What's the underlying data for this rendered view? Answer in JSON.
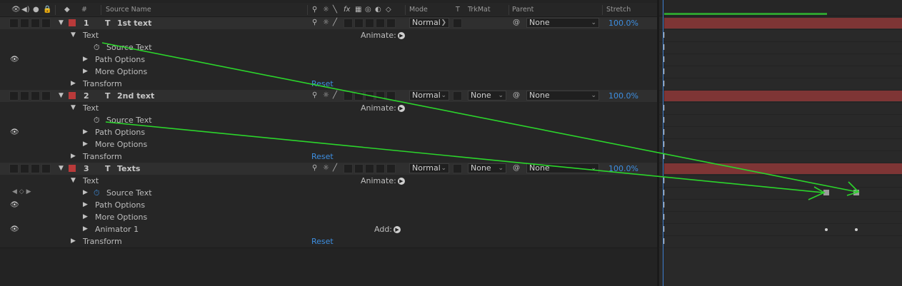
{
  "header": {
    "num_label": "#",
    "source_name_label": "Source Name",
    "fx_label": "fx",
    "mode_label": "Mode",
    "t_label": "T",
    "trkmat_label": "TrkMat",
    "parent_label": "Parent",
    "stretch_label": "Stretch"
  },
  "layers": [
    {
      "num": "1",
      "type_glyph": "T",
      "name": "1st text",
      "mode": "Normal",
      "trkmat": "",
      "parent": "None",
      "stretch": "100.0%",
      "text_label": "Text",
      "animate_label": "Animate:",
      "source_text_label": "Source Text",
      "path_options_label": "Path Options",
      "more_options_label": "More Options",
      "transform_label": "Transform",
      "reset_label": "Reset"
    },
    {
      "num": "2",
      "type_glyph": "T",
      "name": "2nd text",
      "mode": "Normal",
      "trkmat": "None",
      "parent": "None",
      "stretch": "100.0%",
      "text_label": "Text",
      "animate_label": "Animate:",
      "source_text_label": "Source Text",
      "path_options_label": "Path Options",
      "more_options_label": "More Options",
      "transform_label": "Transform",
      "reset_label": "Reset"
    },
    {
      "num": "3",
      "type_glyph": "T",
      "name": "Texts",
      "mode": "Normal",
      "trkmat": "None",
      "parent": "None",
      "stretch": "100.0%",
      "text_label": "Text",
      "animate_label": "Animate:",
      "source_text_label": "Source Text",
      "path_options_label": "Path Options",
      "more_options_label": "More Options",
      "animator_label": "Animator 1",
      "add_label": "Add:",
      "transform_label": "Transform",
      "reset_label": "Reset"
    }
  ],
  "colors": {
    "label_red": "#b93a3a",
    "timeline_bar": "#7e3535",
    "link_blue": "#3d8ee0",
    "annotation_green": "#2bd52b",
    "work_area": "#2fa02f"
  },
  "icons": [
    "eye-icon",
    "speaker-icon",
    "solo-icon",
    "lock-icon",
    "label-tag-icon",
    "stopwatch-icon",
    "spiral-pickwhip-icon",
    "chevron-down-icon",
    "play-circle-icon",
    "keyframe-navigator-icon"
  ]
}
